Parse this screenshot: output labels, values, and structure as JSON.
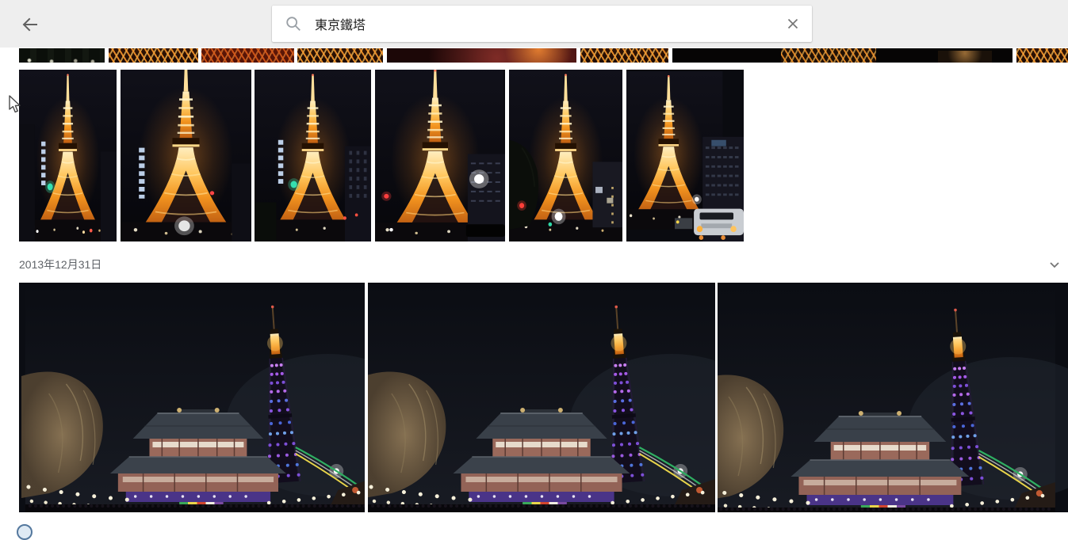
{
  "header": {
    "search_query": "東京鐵塔",
    "back_icon": "arrow-left",
    "search_icon": "magnifier",
    "clear_icon": "close-x"
  },
  "date_section": {
    "date_label": "2013年12月31日",
    "collapse_icon": "chevron-down"
  },
  "photos": {
    "partial_row": [
      "night crowd thumbnail (cropped)",
      "Tokyo Tower steel truss thumbnail (cropped)",
      "Tokyo Tower steel truss thumbnail (cropped)",
      "Tokyo Tower steel truss thumbnail (cropped)",
      "blurred red night close-up thumbnail (cropped)",
      "Tokyo Tower steel truss thumbnail (cropped)",
      "dark night truss thumbnail (cropped)",
      "Tokyo Tower steel truss thumbnail (cropped)"
    ],
    "tower_row": [
      "Tokyo Tower lit orange at night 1",
      "Tokyo Tower lit orange at night 2",
      "Tokyo Tower lit orange at night 3",
      "Tokyo Tower lit orange at night 4",
      "Tokyo Tower lit orange at night 5",
      "Tokyo Tower at night with van on street 6"
    ],
    "temple_row": [
      "Zojoji temple with Tokyo Tower in purple lights 1",
      "Zojoji temple with Tokyo Tower in purple lights 2",
      "Zojoji temple with Tokyo Tower in purple lights 3"
    ]
  },
  "colors": {
    "header_bg": "#eeeeee",
    "tower_orange": "#f2931f",
    "tower_purple": "#7d4fd8",
    "night_sky": "#0a0b10",
    "icon_gray": "#757575"
  }
}
